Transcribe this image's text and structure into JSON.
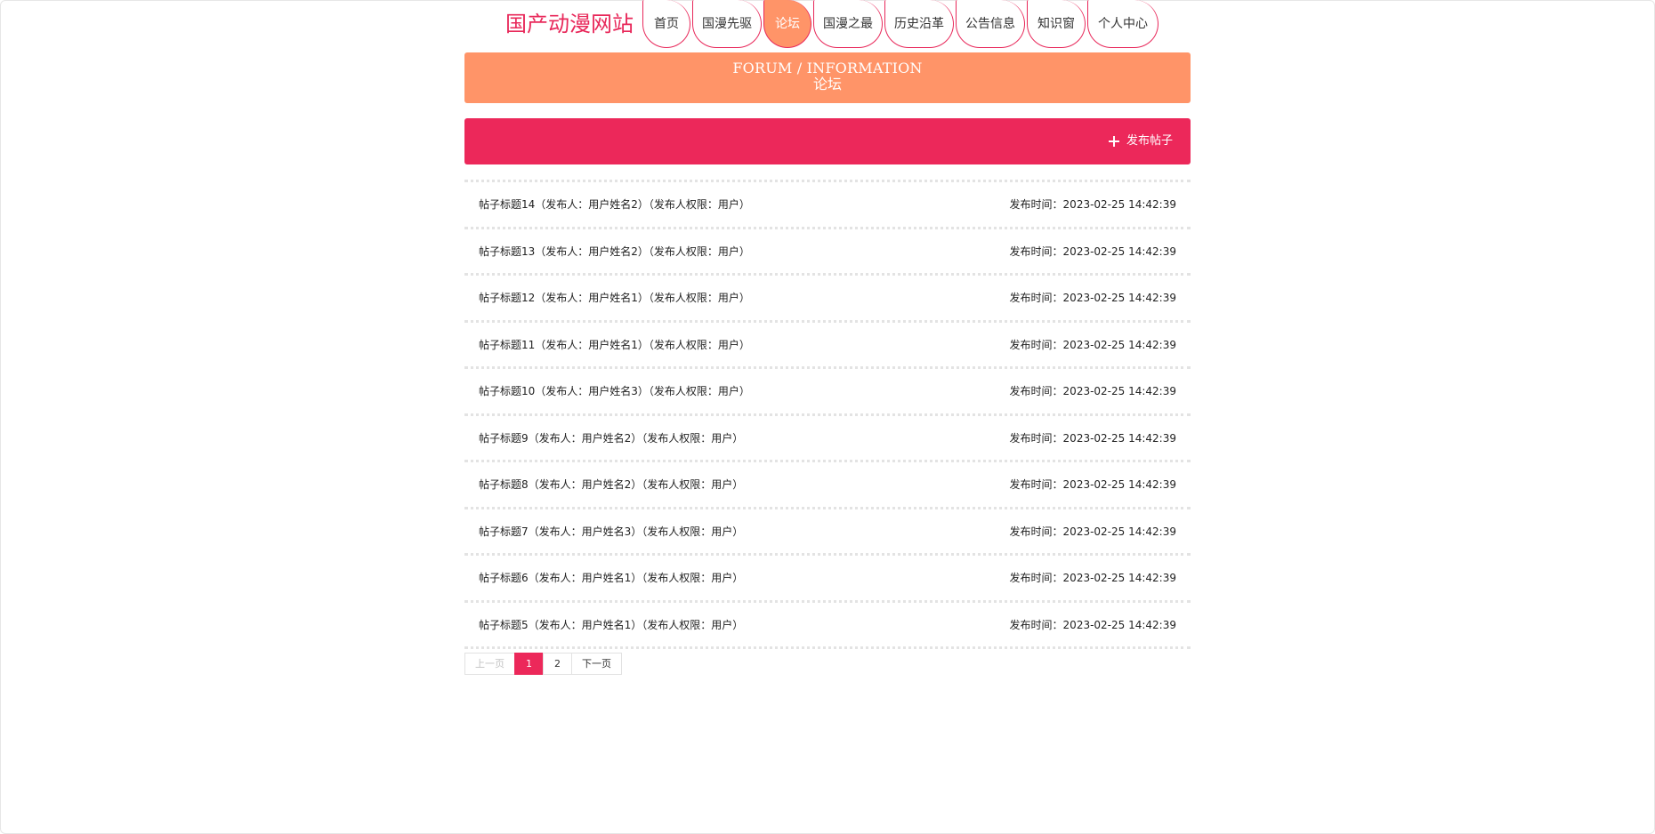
{
  "site": {
    "logo": "国产动漫网站"
  },
  "nav": {
    "items": [
      {
        "label": "首页"
      },
      {
        "label": "国漫先驱"
      },
      {
        "label": "论坛"
      },
      {
        "label": "国漫之最"
      },
      {
        "label": "历史沿革"
      },
      {
        "label": "公告信息"
      },
      {
        "label": "知识窗"
      },
      {
        "label": "个人中心"
      }
    ],
    "active_index": 2
  },
  "banner": {
    "en": "FORUM / INFORMATION",
    "cn": "论坛"
  },
  "actions": {
    "publish_label": "发布帖子"
  },
  "posts": [
    {
      "title": "帖子标题14（发布人：用户姓名2）（发布人权限：用户）",
      "time": "发布时间：2023-02-25 14:42:39"
    },
    {
      "title": "帖子标题13（发布人：用户姓名2）（发布人权限：用户）",
      "time": "发布时间：2023-02-25 14:42:39"
    },
    {
      "title": "帖子标题12（发布人：用户姓名1）（发布人权限：用户）",
      "time": "发布时间：2023-02-25 14:42:39"
    },
    {
      "title": "帖子标题11（发布人：用户姓名1）（发布人权限：用户）",
      "time": "发布时间：2023-02-25 14:42:39"
    },
    {
      "title": "帖子标题10（发布人：用户姓名3）（发布人权限：用户）",
      "time": "发布时间：2023-02-25 14:42:39"
    },
    {
      "title": "帖子标题9（发布人：用户姓名2）（发布人权限：用户）",
      "time": "发布时间：2023-02-25 14:42:39"
    },
    {
      "title": "帖子标题8（发布人：用户姓名2）（发布人权限：用户）",
      "time": "发布时间：2023-02-25 14:42:39"
    },
    {
      "title": "帖子标题7（发布人：用户姓名3）（发布人权限：用户）",
      "time": "发布时间：2023-02-25 14:42:39"
    },
    {
      "title": "帖子标题6（发布人：用户姓名1）（发布人权限：用户）",
      "time": "发布时间：2023-02-25 14:42:39"
    },
    {
      "title": "帖子标题5（发布人：用户姓名1）（发布人权限：用户）",
      "time": "发布时间：2023-02-25 14:42:39"
    }
  ],
  "pagination": {
    "prev": "上一页",
    "pages": [
      "1",
      "2"
    ],
    "current": "1",
    "next": "下一页"
  },
  "colors": {
    "brand": "#e8285a",
    "accent": "#ff9468",
    "bar": "#ec285a"
  }
}
